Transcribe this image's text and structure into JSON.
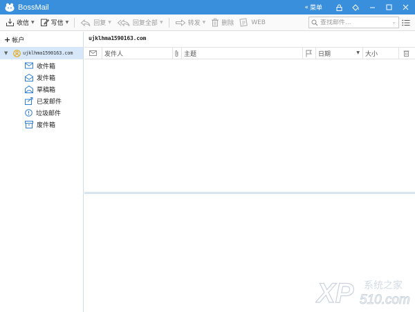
{
  "titlebar": {
    "app_title": "BossMail",
    "menu_label": "菜单",
    "menu_glyph": "«"
  },
  "toolbar": {
    "receive_label": "收信",
    "compose_label": "写信",
    "reply_label": "回复",
    "reply_all_label": "回复全部",
    "forward_label": "转发",
    "delete_label": "删除",
    "web_label": "WEB",
    "search_placeholder": "查找邮件..."
  },
  "sidebar": {
    "add_account_label": "帐户",
    "account_email": "ujklhma1590163.com",
    "folders": [
      {
        "label": "收件箱",
        "icon": "inbox-icon"
      },
      {
        "label": "发件箱",
        "icon": "outbox-icon"
      },
      {
        "label": "草稿箱",
        "icon": "drafts-icon"
      },
      {
        "label": "已发邮件",
        "icon": "sent-icon"
      },
      {
        "label": "垃圾邮件",
        "icon": "spam-icon"
      },
      {
        "label": "废件箱",
        "icon": "trash-icon"
      }
    ]
  },
  "main": {
    "account_header": "ujklhma1590163.com",
    "columns": {
      "sender": "发件人",
      "subject": "主题",
      "date": "日期",
      "size": "大小"
    }
  },
  "watermark": {
    "brand": "XP",
    "tagline": "系统之家",
    "domain": "510.com"
  },
  "colors": {
    "titlebar": "#3a8fdc",
    "selection": "#d6e7fa",
    "icon_blue": "#2f7fd1"
  }
}
